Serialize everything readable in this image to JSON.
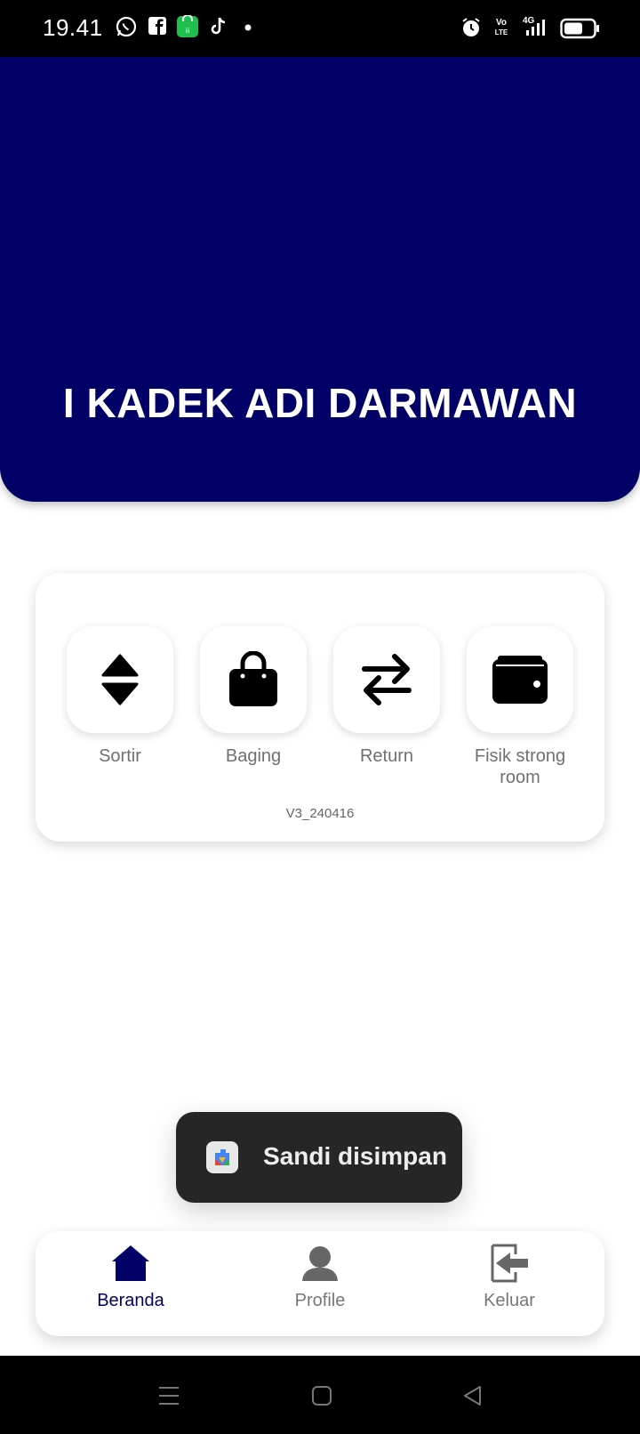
{
  "status_bar": {
    "time": "19.41",
    "volte_label_top": "Vo",
    "volte_label_bottom": "LTE",
    "network": "4G",
    "icons": [
      "whatsapp-icon",
      "facebook-icon",
      "store-icon",
      "tiktok-icon",
      "dot-icon",
      "alarm-icon",
      "volte-icon",
      "signal-icon",
      "battery-icon"
    ]
  },
  "header": {
    "name": "I KADEK ADI DARMAWAN",
    "color": "#000066"
  },
  "menu": {
    "items": [
      {
        "label": "Sortir",
        "icon": "sort-icon"
      },
      {
        "label": "Baging",
        "icon": "bag-icon"
      },
      {
        "label": "Return",
        "icon": "swap-arrows-icon"
      },
      {
        "label": "Fisik strong room",
        "icon": "wallet-icon"
      }
    ],
    "version": "V3_240416"
  },
  "toast": {
    "text": "Sandi disimpan",
    "icon": "google-play-services-icon"
  },
  "bottom_nav": {
    "items": [
      {
        "label": "Beranda",
        "icon": "home-icon",
        "active": true
      },
      {
        "label": "Profile",
        "icon": "person-icon",
        "active": false
      },
      {
        "label": "Keluar",
        "icon": "logout-icon",
        "active": false
      }
    ],
    "active_color": "#000066",
    "inactive_color": "#777777"
  },
  "system_nav": {
    "icons": [
      "menu-icon",
      "home-square-icon",
      "back-icon"
    ]
  }
}
